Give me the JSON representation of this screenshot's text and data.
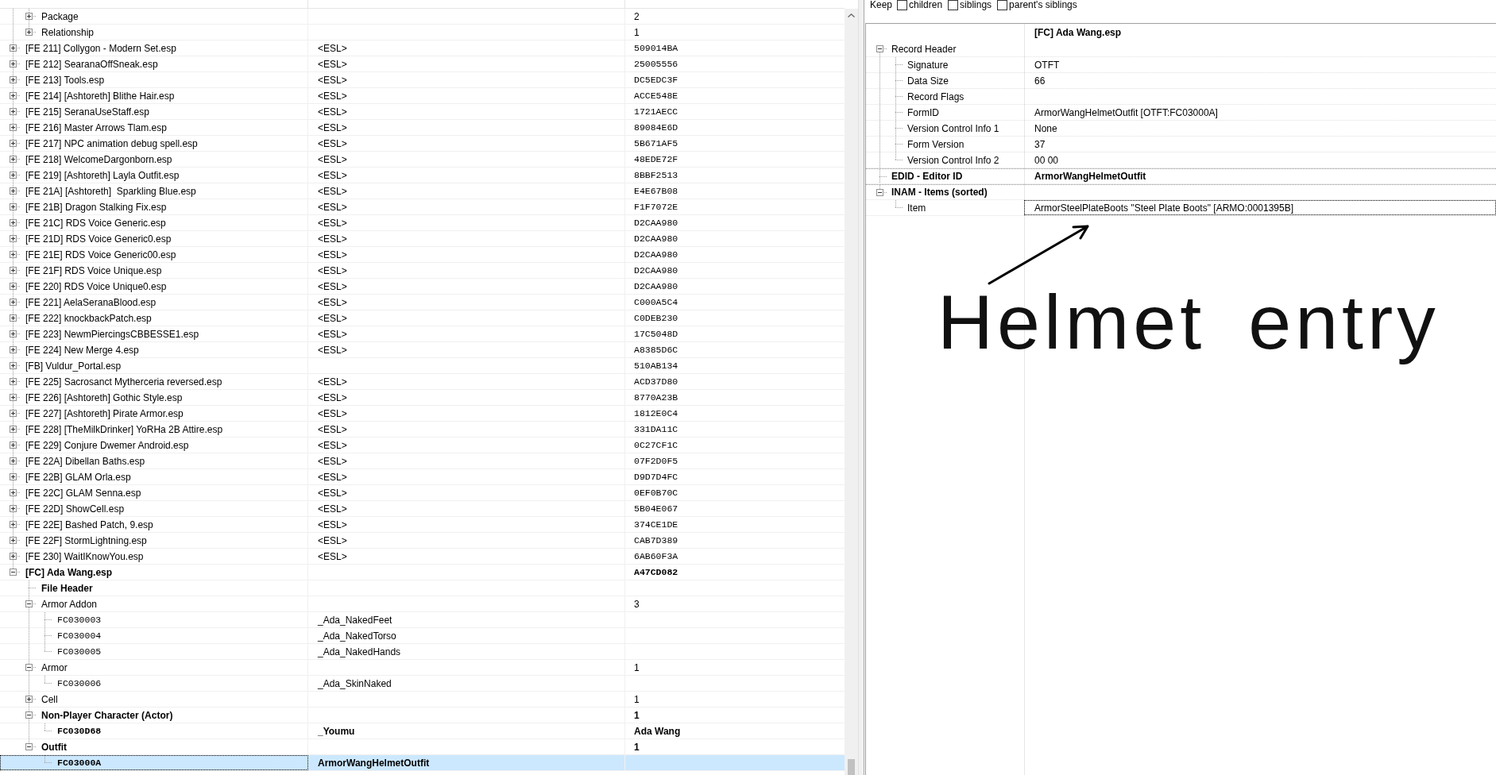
{
  "navigation": {
    "rows": [
      {
        "children": [
          {
            "kind": "group",
            "form_id": "Package",
            "name": "2",
            "expanded": false,
            "emphasized": false,
            "selected": false
          },
          {
            "kind": "group",
            "form_id": "Relationship",
            "name": "1",
            "expanded": false,
            "emphasized": false,
            "selected": false
          }
        ]
      },
      {
        "kind": "plugin",
        "form_id": "[FE 211] Collygon - Modern Set.esp",
        "editor_id": "<ESL>",
        "name": "509014BA",
        "expanded": false,
        "emphasized": false,
        "selected": false
      },
      {
        "kind": "plugin",
        "form_id": "[FE 212] SearanaOffSneak.esp",
        "editor_id": "<ESL>",
        "name": "25005556",
        "expanded": false,
        "emphasized": false,
        "selected": false
      },
      {
        "kind": "plugin",
        "form_id": "[FE 213] Tools.esp",
        "editor_id": "<ESL>",
        "name": "DC5EDC3F",
        "expanded": false,
        "emphasized": false,
        "selected": false
      },
      {
        "kind": "plugin",
        "form_id": "[FE 214] [Ashtoreth] Blithe Hair.esp",
        "editor_id": "<ESL>",
        "name": "ACCE548E",
        "expanded": false,
        "emphasized": false,
        "selected": false
      },
      {
        "kind": "plugin",
        "form_id": "[FE 215] SeranaUseStaff.esp",
        "editor_id": "<ESL>",
        "name": "1721AECC",
        "expanded": false,
        "emphasized": false,
        "selected": false
      },
      {
        "kind": "plugin",
        "form_id": "[FE 216] Master Arrows Tlam.esp",
        "editor_id": "<ESL>",
        "name": "89084E6D",
        "expanded": false,
        "emphasized": false,
        "selected": false
      },
      {
        "kind": "plugin",
        "form_id": "[FE 217] NPC animation debug spell.esp",
        "editor_id": "<ESL>",
        "name": "5B671AF5",
        "expanded": false,
        "emphasized": false,
        "selected": false
      },
      {
        "kind": "plugin",
        "form_id": "[FE 218] WelcomeDargonborn.esp",
        "editor_id": "<ESL>",
        "name": "48EDE72F",
        "expanded": false,
        "emphasized": false,
        "selected": false
      },
      {
        "kind": "plugin",
        "form_id": "[FE 219] [Ashtoreth] Layla Outfit.esp",
        "editor_id": "<ESL>",
        "name": "8BBF2513",
        "expanded": false,
        "emphasized": false,
        "selected": false
      },
      {
        "kind": "plugin",
        "form_id": "[FE 21A] [Ashtoreth]  Sparkling Blue.esp",
        "editor_id": "<ESL>",
        "name": "E4E67B08",
        "expanded": false,
        "emphasized": false,
        "selected": false
      },
      {
        "kind": "plugin",
        "form_id": "[FE 21B] Dragon Stalking Fix.esp",
        "editor_id": "<ESL>",
        "name": "F1F7072E",
        "expanded": false,
        "emphasized": false,
        "selected": false
      },
      {
        "kind": "plugin",
        "form_id": "[FE 21C] RDS Voice Generic.esp",
        "editor_id": "<ESL>",
        "name": "D2CAA980",
        "expanded": false,
        "emphasized": false,
        "selected": false
      },
      {
        "kind": "plugin",
        "form_id": "[FE 21D] RDS Voice Generic0.esp",
        "editor_id": "<ESL>",
        "name": "D2CAA980",
        "expanded": false,
        "emphasized": false,
        "selected": false
      },
      {
        "kind": "plugin",
        "form_id": "[FE 21E] RDS Voice Generic00.esp",
        "editor_id": "<ESL>",
        "name": "D2CAA980",
        "expanded": false,
        "emphasized": false,
        "selected": false
      },
      {
        "kind": "plugin",
        "form_id": "[FE 21F] RDS Voice Unique.esp",
        "editor_id": "<ESL>",
        "name": "D2CAA980",
        "expanded": false,
        "emphasized": false,
        "selected": false
      },
      {
        "kind": "plugin",
        "form_id": "[FE 220] RDS Voice Unique0.esp",
        "editor_id": "<ESL>",
        "name": "D2CAA980",
        "expanded": false,
        "emphasized": false,
        "selected": false
      },
      {
        "kind": "plugin",
        "form_id": "[FE 221] AelaSeranaBlood.esp",
        "editor_id": "<ESL>",
        "name": "C000A5C4",
        "expanded": false,
        "emphasized": false,
        "selected": false
      },
      {
        "kind": "plugin",
        "form_id": "[FE 222] knockbackPatch.esp",
        "editor_id": "<ESL>",
        "name": "C0DEB230",
        "expanded": false,
        "emphasized": false,
        "selected": false
      },
      {
        "kind": "plugin",
        "form_id": "[FE 223] NewmPiercingsCBBESSE1.esp",
        "editor_id": "<ESL>",
        "name": "17C5048D",
        "expanded": false,
        "emphasized": false,
        "selected": false
      },
      {
        "kind": "plugin",
        "form_id": "[FE 224] New Merge 4.esp",
        "editor_id": "<ESL>",
        "name": "A8385D6C",
        "expanded": false,
        "emphasized": false,
        "selected": false
      },
      {
        "kind": "plugin",
        "form_id": "[FB] Vuldur_Portal.esp",
        "name": "510AB134",
        "expanded": false,
        "emphasized": false,
        "selected": false
      },
      {
        "kind": "plugin",
        "form_id": "[FE 225] Sacrosanct Mytherceria reversed.esp",
        "editor_id": "<ESL>",
        "name": "ACD37D80",
        "expanded": false,
        "emphasized": false,
        "selected": false
      },
      {
        "kind": "plugin",
        "form_id": "[FE 226] [Ashtoreth] Gothic Style.esp",
        "editor_id": "<ESL>",
        "name": "8770A23B",
        "expanded": false,
        "emphasized": false,
        "selected": false
      },
      {
        "kind": "plugin",
        "form_id": "[FE 227] [Ashtoreth] Pirate Armor.esp",
        "editor_id": "<ESL>",
        "name": "1812E0C4",
        "expanded": false,
        "emphasized": false,
        "selected": false
      },
      {
        "kind": "plugin",
        "form_id": "[FE 228] [TheMilkDrinker] YoRHa 2B Attire.esp",
        "editor_id": "<ESL>",
        "name": "331DA11C",
        "expanded": false,
        "emphasized": false,
        "selected": false
      },
      {
        "kind": "plugin",
        "form_id": "[FE 229] Conjure Dwemer Android.esp",
        "editor_id": "<ESL>",
        "name": "0C27CF1C",
        "expanded": false,
        "emphasized": false,
        "selected": false
      },
      {
        "kind": "plugin",
        "form_id": "[FE 22A] Dibellan Baths.esp",
        "editor_id": "<ESL>",
        "name": "07F2D0F5",
        "expanded": false,
        "emphasized": false,
        "selected": false
      },
      {
        "kind": "plugin",
        "form_id": "[FE 22B] GLAM Orla.esp",
        "editor_id": "<ESL>",
        "name": "D9D7D4FC",
        "expanded": false,
        "emphasized": false,
        "selected": false
      },
      {
        "kind": "plugin",
        "form_id": "[FE 22C] GLAM Senna.esp",
        "editor_id": "<ESL>",
        "name": "0EF0B70C",
        "expanded": false,
        "emphasized": false,
        "selected": false
      },
      {
        "kind": "plugin",
        "form_id": "[FE 22D] ShowCell.esp",
        "editor_id": "<ESL>",
        "name": "5B04E067",
        "expanded": false,
        "emphasized": false,
        "selected": false
      },
      {
        "kind": "plugin",
        "form_id": "[FE 22E] Bashed Patch, 9.esp",
        "editor_id": "<ESL>",
        "name": "374CE1DE",
        "expanded": false,
        "emphasized": false,
        "selected": false
      },
      {
        "kind": "plugin",
        "form_id": "[FE 22F] StormLightning.esp",
        "editor_id": "<ESL>",
        "name": "CAB7D389",
        "expanded": false,
        "emphasized": false,
        "selected": false
      },
      {
        "kind": "plugin",
        "form_id": "[FE 230] WaitIKnowYou.esp",
        "editor_id": "<ESL>",
        "name": "6AB60F3A",
        "expanded": false,
        "emphasized": false,
        "selected": false
      },
      {
        "kind": "plugin",
        "form_id": "[FC] Ada Wang.esp",
        "name": "A47CD082",
        "expanded": true,
        "emphasized": true,
        "selected": false,
        "children": [
          {
            "kind": "header",
            "form_id": "File Header",
            "emphasized": true,
            "selected": false
          },
          {
            "kind": "group",
            "form_id": "Armor Addon",
            "name": "3",
            "expanded": true,
            "emphasized": false,
            "selected": false,
            "children": [
              {
                "kind": "record",
                "form_id": "FC030003",
                "editor_id": "_Ada_NakedFeet",
                "emphasized": false,
                "selected": false
              },
              {
                "kind": "record",
                "form_id": "FC030004",
                "editor_id": "_Ada_NakedTorso",
                "emphasized": false,
                "selected": false
              },
              {
                "kind": "record",
                "form_id": "FC030005",
                "editor_id": "_Ada_NakedHands",
                "emphasized": false,
                "selected": false
              }
            ]
          },
          {
            "kind": "group",
            "form_id": "Armor",
            "name": "1",
            "expanded": true,
            "emphasized": false,
            "selected": false,
            "children": [
              {
                "kind": "record",
                "form_id": "FC030006",
                "editor_id": "_Ada_SkinNaked",
                "emphasized": false,
                "selected": false
              }
            ]
          },
          {
            "kind": "group",
            "form_id": "Cell",
            "name": "1",
            "expanded": false,
            "emphasized": false,
            "selected": false
          },
          {
            "kind": "group",
            "form_id": "Non-Player Character (Actor)",
            "name": "1",
            "expanded": true,
            "emphasized": true,
            "selected": false,
            "children": [
              {
                "kind": "record",
                "form_id": "FC030D68",
                "editor_id": "_Youmu",
                "name": "Ada Wang",
                "emphasized": true,
                "selected": false
              }
            ]
          },
          {
            "kind": "group",
            "form_id": "Outfit",
            "name": "1",
            "expanded": true,
            "emphasized": true,
            "selected": false,
            "children": [
              {
                "kind": "record",
                "form_id": "FC03000A",
                "editor_id": "ArmorWangHelmetOutfit",
                "emphasized": true,
                "selected": true
              }
            ]
          }
        ]
      }
    ]
  },
  "record_view": {
    "keep": {
      "label": "Keep",
      "options": [
        {
          "label": "children",
          "checked": false
        },
        {
          "label": "siblings",
          "checked": false
        },
        {
          "label": "parent's siblings",
          "checked": false
        }
      ]
    },
    "column_header": "[FC] Ada Wang.esp",
    "rows": [
      {
        "label": "Record Header",
        "expanded": true,
        "emphasized": false,
        "selected": false,
        "children": [
          {
            "label": "Signature",
            "value": "OTFT",
            "emphasized": false,
            "selected": false
          },
          {
            "label": "Data Size",
            "value": "66",
            "emphasized": false,
            "selected": false
          },
          {
            "label": "Record Flags",
            "emphasized": false,
            "selected": false
          },
          {
            "label": "FormID",
            "value": "ArmorWangHelmetOutfit [OTFT:FC03000A]",
            "emphasized": false,
            "selected": false
          },
          {
            "label": "Version Control Info 1",
            "value": "None",
            "emphasized": false,
            "selected": false
          },
          {
            "label": "Form Version",
            "value": "37",
            "emphasized": false,
            "selected": false
          },
          {
            "label": "Version Control Info 2",
            "value": "00 00",
            "emphasized": false,
            "selected": false
          }
        ]
      },
      {
        "label": "EDID - Editor ID",
        "value": "ArmorWangHelmetOutfit",
        "emphasized": true,
        "selected": false
      },
      {
        "label": "INAM - Items (sorted)",
        "expanded": true,
        "emphasized": true,
        "selected": false,
        "children": [
          {
            "label": "Item",
            "value": "ArmorSteelPlateBoots \"Steel Plate Boots\" [ARMO:0001395B]",
            "emphasized": false,
            "selected": true
          }
        ]
      }
    ]
  },
  "annotation": {
    "text": "Helmet entry"
  }
}
